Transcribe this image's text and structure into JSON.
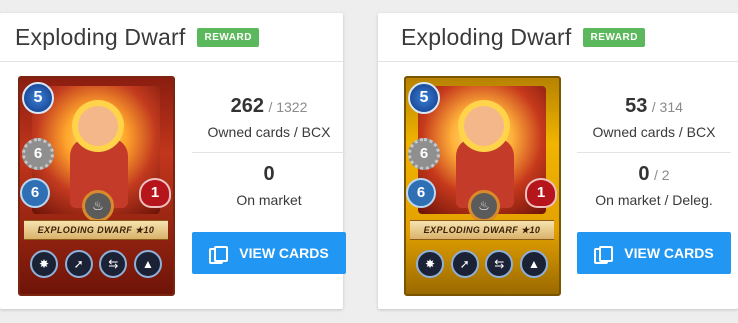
{
  "cards": [
    {
      "title": "Exploding Dwarf",
      "badge": "REWARD",
      "card_name": "EXPLODING DWARF ★10",
      "mana": "5",
      "attack": "6",
      "speed": "6",
      "health": "1",
      "owned": "262",
      "owned_total": "/ 1322",
      "owned_label": "Owned cards / BCX",
      "market": "0",
      "market_total": "",
      "market_label": "On market",
      "button": "VIEW CARDS",
      "edition": "regular"
    },
    {
      "title": "Exploding Dwarf",
      "badge": "REWARD",
      "card_name": "EXPLODING DWARF ★10",
      "mana": "5",
      "attack": "6",
      "speed": "6",
      "health": "1",
      "owned": "53",
      "owned_total": "/ 314",
      "owned_label": "Owned cards / BCX",
      "market": "0",
      "market_total": "/ 2",
      "market_label": "On market / Deleg.",
      "button": "VIEW CARDS",
      "edition": "gold"
    }
  ],
  "icons": [
    "fire-element-icon",
    "blast-ability-icon",
    "sneak-ability-icon",
    "swap-ability-icon",
    "shield-ability-icon",
    "view-cards-icon"
  ],
  "colors": {
    "badge": "#5cb85c",
    "button": "#2196f3",
    "regular_frame": "#c2361c",
    "gold_frame": "#f0b400"
  }
}
